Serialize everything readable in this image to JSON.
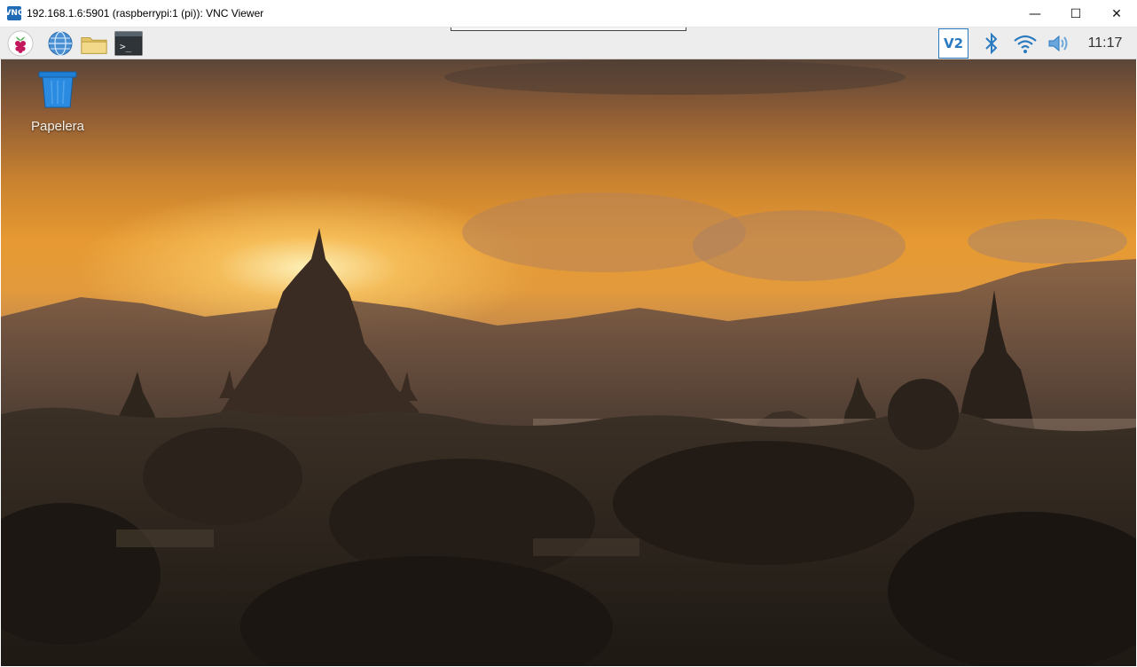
{
  "window": {
    "app_icon": "VNC",
    "title": "192.168.1.6:5901 (raspberrypi:1 (pi)): VNC Viewer",
    "controls": {
      "minimize": "—",
      "maximize": "☐",
      "close": "✕"
    }
  },
  "panel": {
    "launchers": [
      {
        "name": "raspberry-menu",
        "icon": "raspberry-icon"
      },
      {
        "name": "web-browser",
        "icon": "globe-icon"
      },
      {
        "name": "file-manager",
        "icon": "folder-icon"
      },
      {
        "name": "terminal",
        "icon": "terminal-icon",
        "glyph": ">_"
      }
    ],
    "tray": {
      "vnc": "V2",
      "bluetooth": "bluetooth-icon",
      "wifi": "wifi-icon",
      "volume": "volume-icon",
      "clock": "11:17"
    }
  },
  "desktop": {
    "icons": [
      {
        "label": "Papelera",
        "icon": "trash-icon"
      }
    ],
    "wallpaper": "sunset-temples",
    "colors": {
      "sky_top": "#5b4638",
      "sky_glow": "#e79a32",
      "silhouette": "#2b221a"
    }
  }
}
